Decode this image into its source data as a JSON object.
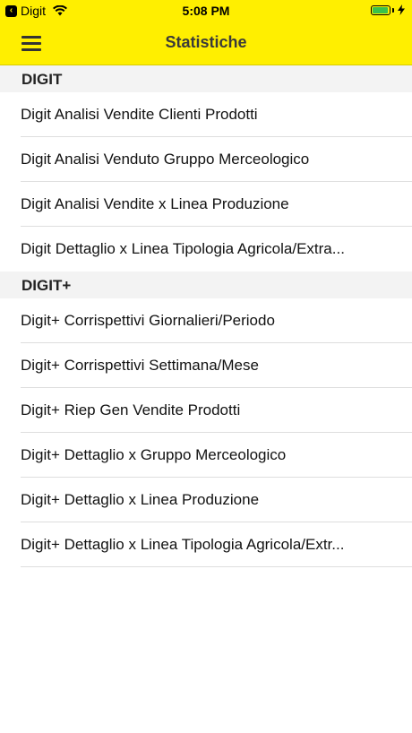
{
  "status_bar": {
    "back_app": "Digit",
    "time": "5:08 PM",
    "battery_percent": 100
  },
  "nav": {
    "title": "Statistiche"
  },
  "sections": [
    {
      "header": "DIGIT",
      "items": [
        "Digit Analisi Vendite Clienti Prodotti",
        "Digit Analisi Venduto Gruppo Merceologico",
        "Digit Analisi Vendite x Linea Produzione",
        "Digit Dettaglio x Linea Tipologia Agricola/Extra..."
      ]
    },
    {
      "header": "DIGIT+",
      "items": [
        "Digit+ Corrispettivi Giornalieri/Periodo",
        "Digit+ Corrispettivi Settimana/Mese",
        "Digit+ Riep Gen Vendite Prodotti",
        "Digit+ Dettaglio x Gruppo Merceologico",
        "Digit+ Dettaglio x Linea Produzione",
        "Digit+ Dettaglio x Linea Tipologia Agricola/Extr..."
      ]
    }
  ],
  "colors": {
    "header_bg": "#FFEF00",
    "section_bg": "#f3f3f3",
    "battery": "#39c24a"
  }
}
